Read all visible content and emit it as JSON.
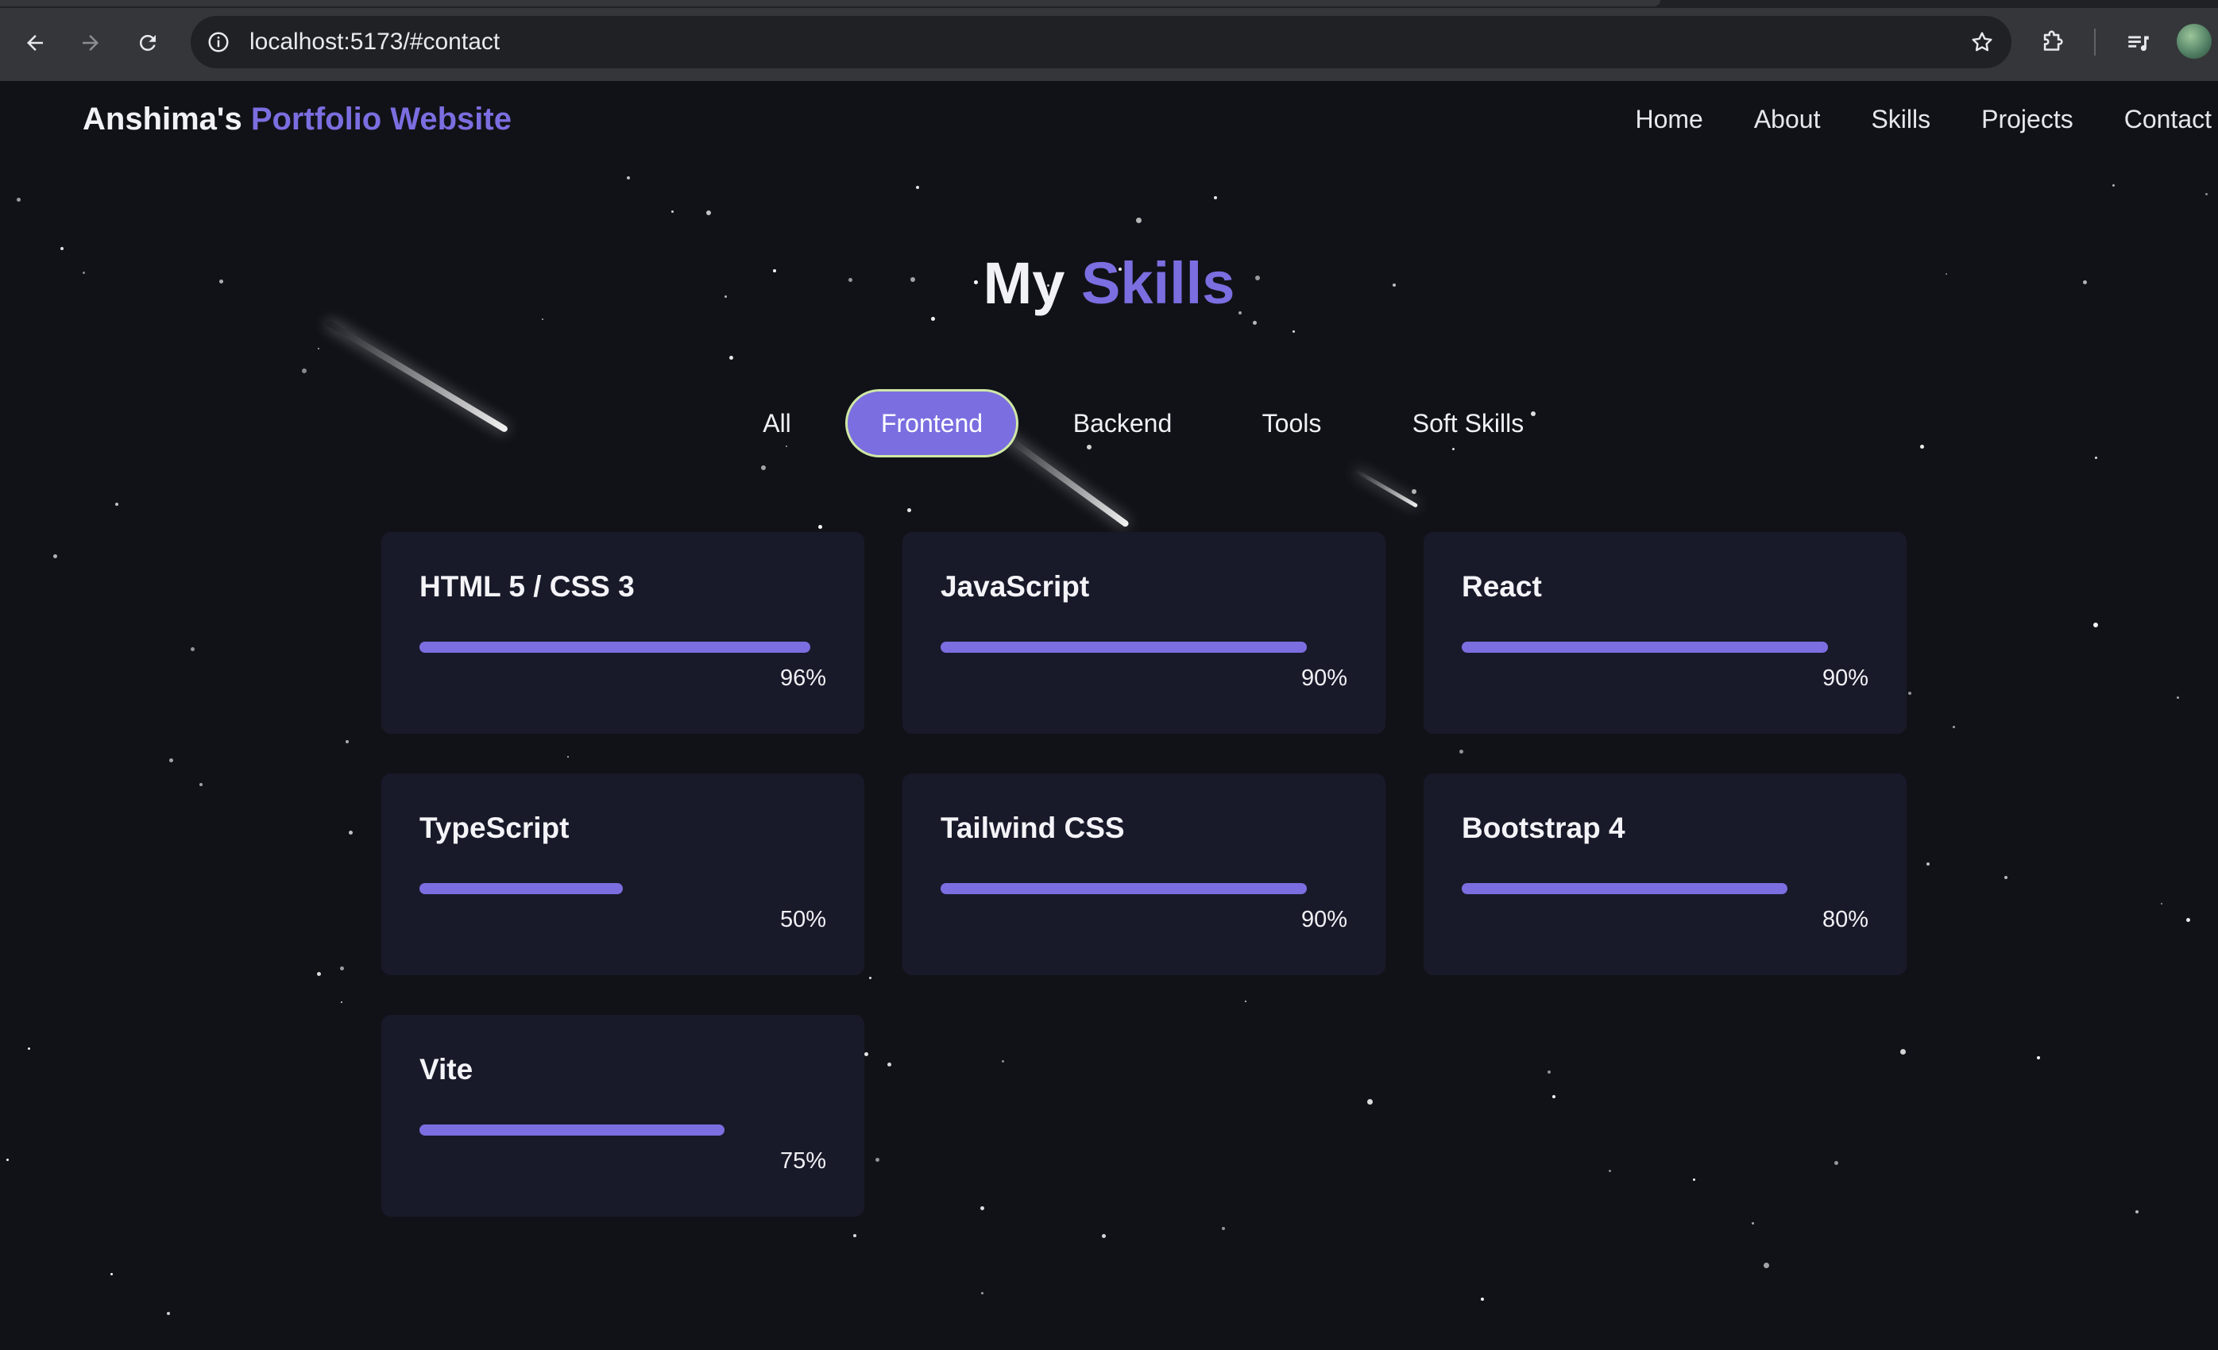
{
  "browser": {
    "url": "localhost:5173/#contact"
  },
  "site": {
    "logo_prefix": "Anshima's",
    "logo_accent": "Portfolio Website",
    "nav": [
      "Home",
      "About",
      "Skills",
      "Projects",
      "Contact"
    ]
  },
  "skills": {
    "title_prefix": "My",
    "title_accent": "Skills",
    "filters": [
      "All",
      "Frontend",
      "Backend",
      "Tools",
      "Soft Skills"
    ],
    "active_filter": "Frontend",
    "items": [
      {
        "name": "HTML 5 / CSS 3",
        "percent_label": "96%",
        "level": 96
      },
      {
        "name": "JavaScript",
        "percent_label": "90%",
        "level": 90
      },
      {
        "name": "React",
        "percent_label": "90%",
        "level": 90
      },
      {
        "name": "TypeScript",
        "percent_label": "50%",
        "level": 50
      },
      {
        "name": "Tailwind CSS",
        "percent_label": "90%",
        "level": 90
      },
      {
        "name": "Bootstrap 4",
        "percent_label": "80%",
        "level": 80
      },
      {
        "name": "Vite",
        "percent_label": "75%",
        "level": 75
      }
    ]
  },
  "colors": {
    "accent": "#7b6ee0",
    "background": "#111218",
    "card": "#181a2a",
    "active_filter_border": "#cfe8a5"
  }
}
